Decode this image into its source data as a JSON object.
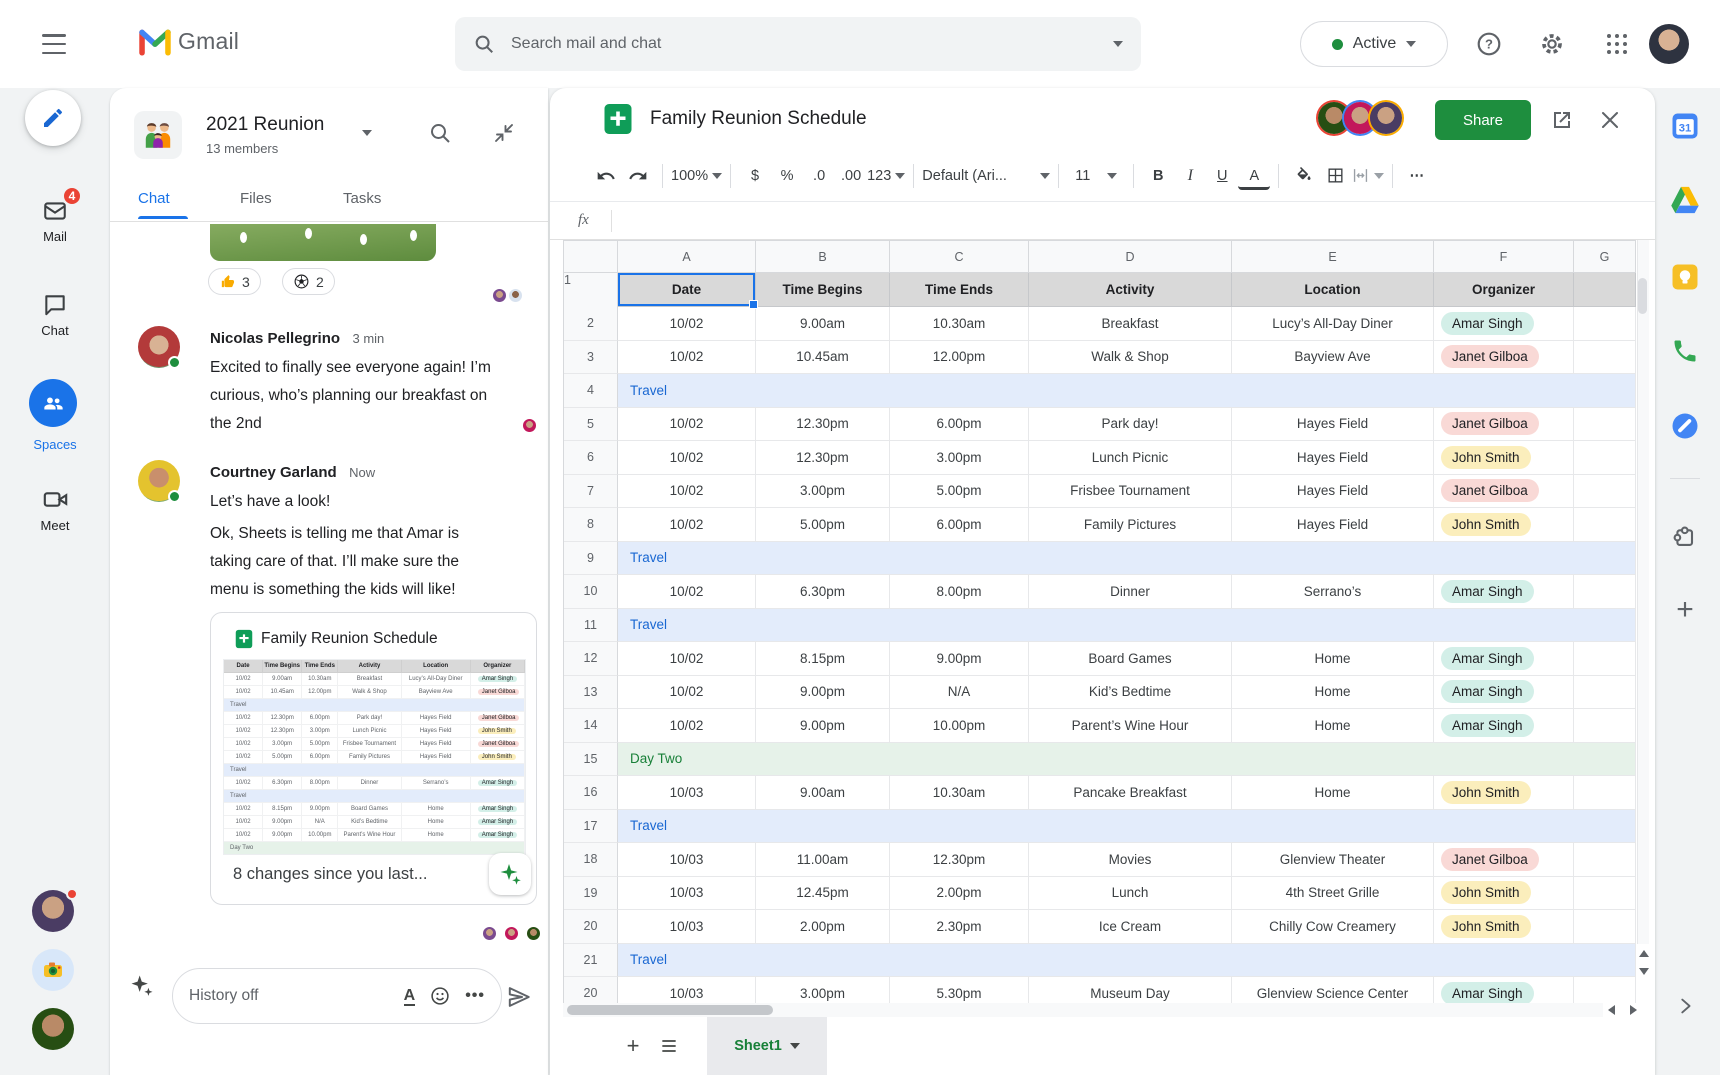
{
  "topbar": {
    "logo_text": "Gmail",
    "search_placeholder": "Search mail and chat",
    "status": "Active"
  },
  "left_rail": {
    "compose": "Compose",
    "items": [
      {
        "label": "Mail",
        "badge": "4"
      },
      {
        "label": "Chat"
      },
      {
        "label": "Spaces",
        "active": true
      },
      {
        "label": "Meet"
      }
    ]
  },
  "chat": {
    "title": "2021 Reunion",
    "members": "13 members",
    "tabs": [
      "Chat",
      "Files",
      "Tasks"
    ],
    "active_tab": "Chat",
    "reactions": [
      {
        "icon": "thumbs-up",
        "count": "3"
      },
      {
        "icon": "soccer-ball",
        "count": "2"
      }
    ],
    "messages": [
      {
        "sender": "Nicolas Pellegrino",
        "time": "3 min",
        "text": "Excited to finally see everyone again! I’m curious, who’s planning our breakfast on the 2nd"
      },
      {
        "sender": "Courtney Garland",
        "time": "Now",
        "text": "Let’s have a look!",
        "text2": "Ok, Sheets is telling me that Amar is taking care of that. I’ll make sure the menu is something the kids will like!"
      }
    ],
    "card": {
      "title": "Family Reunion Schedule",
      "footer": "8 changes since you last..."
    },
    "composer": {
      "placeholder": "History off"
    }
  },
  "sheets": {
    "title": "Family Reunion Schedule",
    "share_label": "Share",
    "toolbar": {
      "zoom": "100%",
      "format_tokens": [
        "$",
        "%",
        ".0",
        ".00",
        "123"
      ],
      "font": "Default (Ari...",
      "font_size": "11",
      "bold": "B",
      "italic": "I",
      "underline": "U",
      "text_color": "A",
      "more": "⋯"
    },
    "formula_label": "fx",
    "columns": [
      "A",
      "B",
      "C",
      "D",
      "E",
      "F",
      "G"
    ],
    "header_row": {
      "num": "1",
      "cells": [
        "Date",
        "Time Begins",
        "Time Ends",
        "Activity",
        "Location",
        "Organizer"
      ]
    },
    "organizer_colors": {
      "Amar Singh": "#d3efe8",
      "Janet Gilboa": "#f9d9d6",
      "John Smith": "#fbeebc"
    },
    "band_colors": {
      "travel": "#e3ecfb",
      "daytwo": "#e6f2e9"
    },
    "rows": [
      {
        "num": "2",
        "date": "10/02",
        "begins": "9.00am",
        "ends": "10.30am",
        "activity": "Breakfast",
        "location": "Lucy’s All-Day Diner",
        "organizer": "Amar Singh"
      },
      {
        "num": "3",
        "date": "10/02",
        "begins": "10.45am",
        "ends": "12.00pm",
        "activity": "Walk & Shop",
        "location": "Bayview Ave",
        "organizer": "Janet Gilboa"
      },
      {
        "num": "4",
        "type": "travel",
        "band": "Travel"
      },
      {
        "num": "5",
        "date": "10/02",
        "begins": "12.30pm",
        "ends": "6.00pm",
        "activity": "Park day!",
        "location": "Hayes Field",
        "organizer": "Janet Gilboa"
      },
      {
        "num": "6",
        "date": "10/02",
        "begins": "12.30pm",
        "ends": "3.00pm",
        "activity": "Lunch Picnic",
        "location": "Hayes Field",
        "organizer": "John Smith"
      },
      {
        "num": "7",
        "date": "10/02",
        "begins": "3.00pm",
        "ends": "5.00pm",
        "activity": "Frisbee Tournament",
        "location": "Hayes Field",
        "organizer": "Janet Gilboa"
      },
      {
        "num": "8",
        "date": "10/02",
        "begins": "5.00pm",
        "ends": "6.00pm",
        "activity": "Family Pictures",
        "location": "Hayes Field",
        "organizer": "John Smith"
      },
      {
        "num": "9",
        "type": "travel",
        "band": "Travel"
      },
      {
        "num": "10",
        "date": "10/02",
        "begins": "6.30pm",
        "ends": "8.00pm",
        "activity": "Dinner",
        "location": "Serrano’s",
        "organizer": "Amar Singh"
      },
      {
        "num": "11",
        "type": "travel",
        "band": "Travel"
      },
      {
        "num": "12",
        "date": "10/02",
        "begins": "8.15pm",
        "ends": "9.00pm",
        "activity": "Board Games",
        "location": "Home",
        "organizer": "Amar Singh"
      },
      {
        "num": "13",
        "date": "10/02",
        "begins": "9.00pm",
        "ends": "N/A",
        "activity": "Kid’s Bedtime",
        "location": "Home",
        "organizer": "Amar Singh"
      },
      {
        "num": "14",
        "date": "10/02",
        "begins": "9.00pm",
        "ends": "10.00pm",
        "activity": "Parent’s Wine Hour",
        "location": "Home",
        "organizer": "Amar Singh"
      },
      {
        "num": "15",
        "type": "daytwo",
        "band": "Day Two"
      },
      {
        "num": "16",
        "date": "10/03",
        "begins": "9.00am",
        "ends": "10.30am",
        "activity": "Pancake Breakfast",
        "location": "Home",
        "organizer": "John Smith"
      },
      {
        "num": "17",
        "type": "travel",
        "band": "Travel"
      },
      {
        "num": "18",
        "date": "10/03",
        "begins": "11.00am",
        "ends": "12.30pm",
        "activity": "Movies",
        "location": "Glenview Theater",
        "organizer": "Janet Gilboa"
      },
      {
        "num": "19",
        "date": "10/03",
        "begins": "12.45pm",
        "ends": "2.00pm",
        "activity": "Lunch",
        "location": "4th Street Grille",
        "organizer": "John Smith"
      },
      {
        "num": "20",
        "date": "10/03",
        "begins": "2.00pm",
        "ends": "2.30pm",
        "activity": "Ice Cream",
        "location": "Chilly Cow Creamery",
        "organizer": "John Smith"
      },
      {
        "num": "21",
        "type": "travel",
        "band": "Travel"
      },
      {
        "num": "20",
        "date": "10/03",
        "begins": "3.00pm",
        "ends": "5.30pm",
        "activity": "Museum Day",
        "location": "Glenview Science Center",
        "organizer": "Amar Singh"
      }
    ],
    "sheet_tab": "Sheet1",
    "add_sheet": "+"
  },
  "colors": {
    "accent_blue": "#1a73e8",
    "sheets_green": "#0f9d58",
    "share_green": "#1e8e3e",
    "badge_red": "#ea4335",
    "travel_row": "#e3ecfb",
    "daytwo_row": "#e6f2e9"
  }
}
